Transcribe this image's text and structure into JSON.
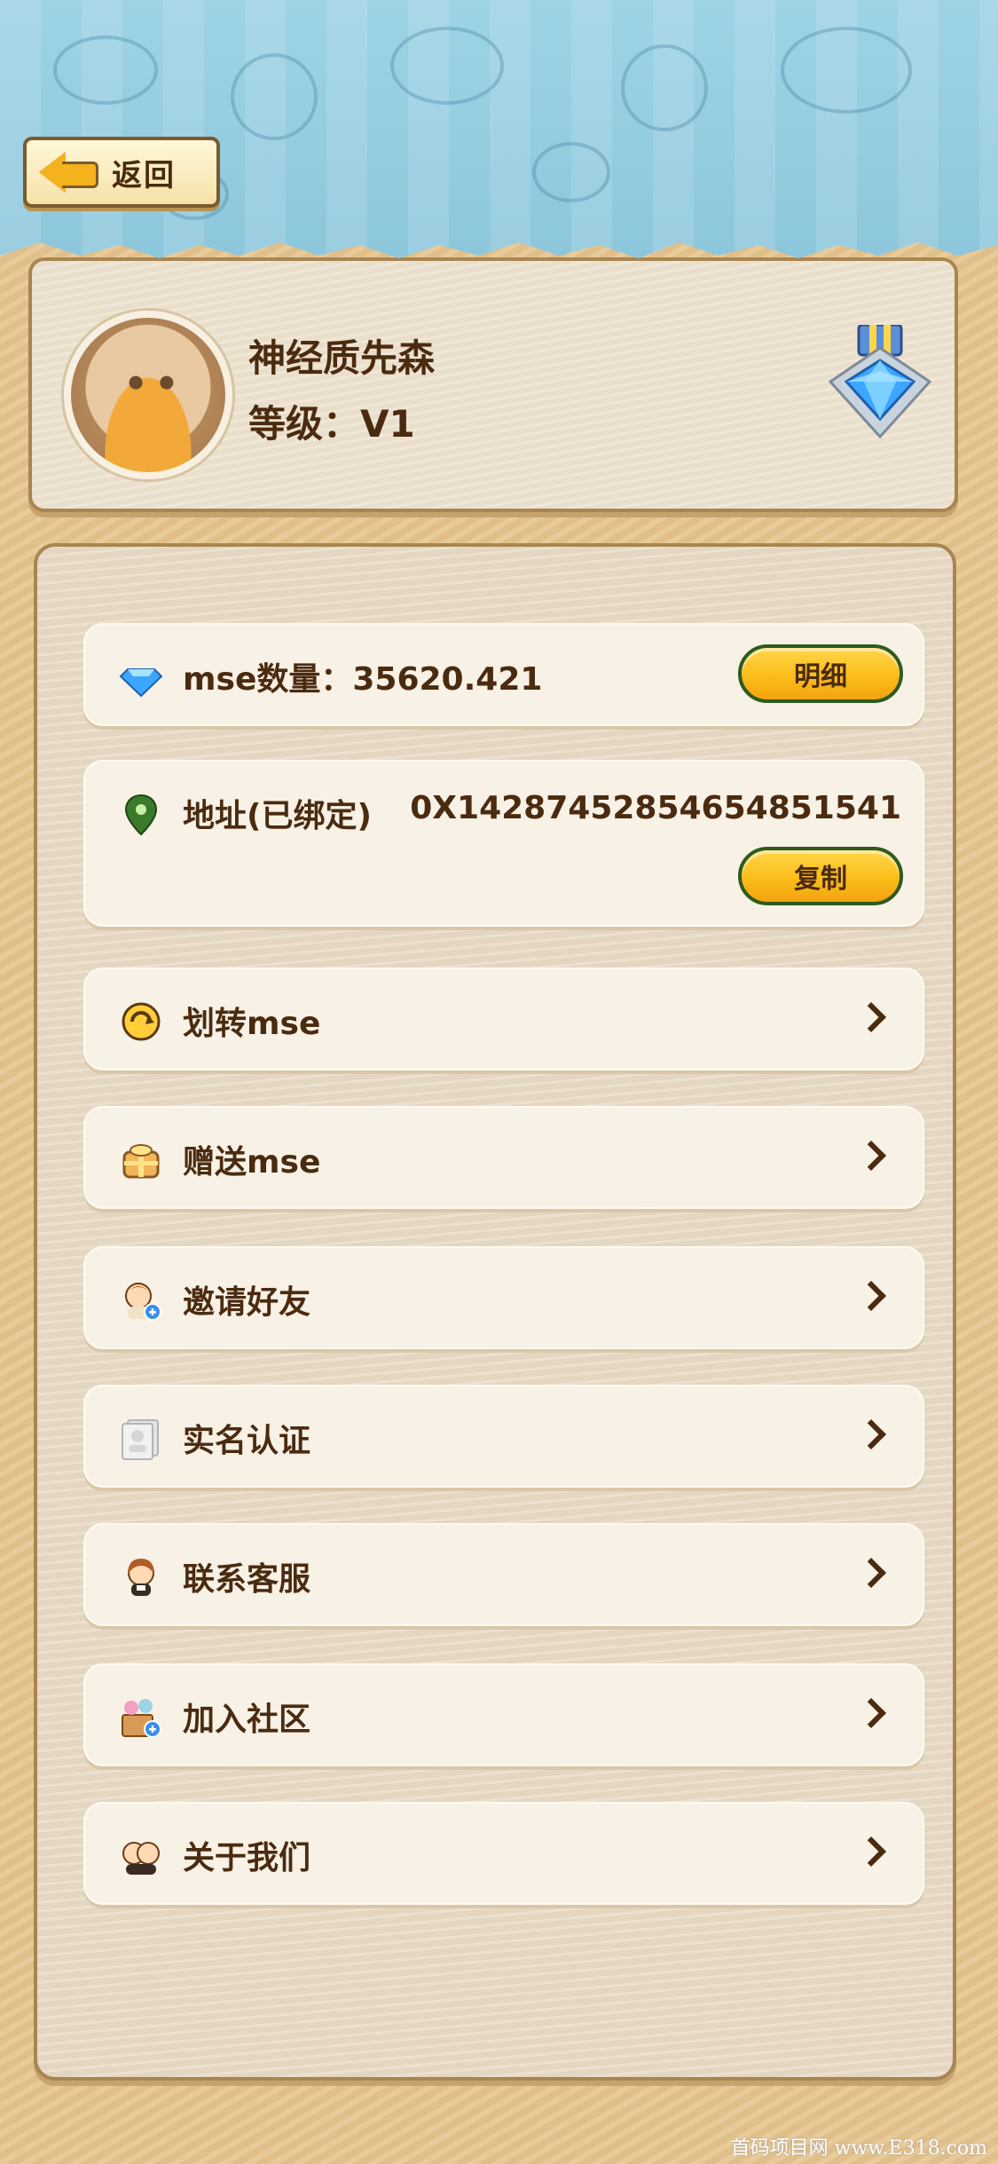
{
  "header": {
    "back_label": "返回"
  },
  "profile": {
    "username": "神经质先森",
    "level": "等级：V1"
  },
  "mse": {
    "label": "mse数量：35620.421",
    "detail_button": "明细"
  },
  "address": {
    "label": "地址(已绑定)",
    "value": "0X14287452854654851541",
    "copy_button": "复制"
  },
  "menu": [
    {
      "label": "划转mse",
      "icon": "transfer-icon"
    },
    {
      "label": "赠送mse",
      "icon": "gift-icon"
    },
    {
      "label": "邀请好友",
      "icon": "invite-friend-icon"
    },
    {
      "label": "实名认证",
      "icon": "id-verify-icon"
    },
    {
      "label": "联系客服",
      "icon": "customer-service-icon"
    },
    {
      "label": "加入社区",
      "icon": "community-icon"
    },
    {
      "label": "关于我们",
      "icon": "about-us-icon"
    }
  ],
  "watermark": "首码项目网 www.E318.com",
  "colors": {
    "text": "#4b2b10",
    "button_yellow": "#fbbd1a",
    "button_border": "#2f5a1e",
    "banner_blue": "#9ed3e6"
  }
}
